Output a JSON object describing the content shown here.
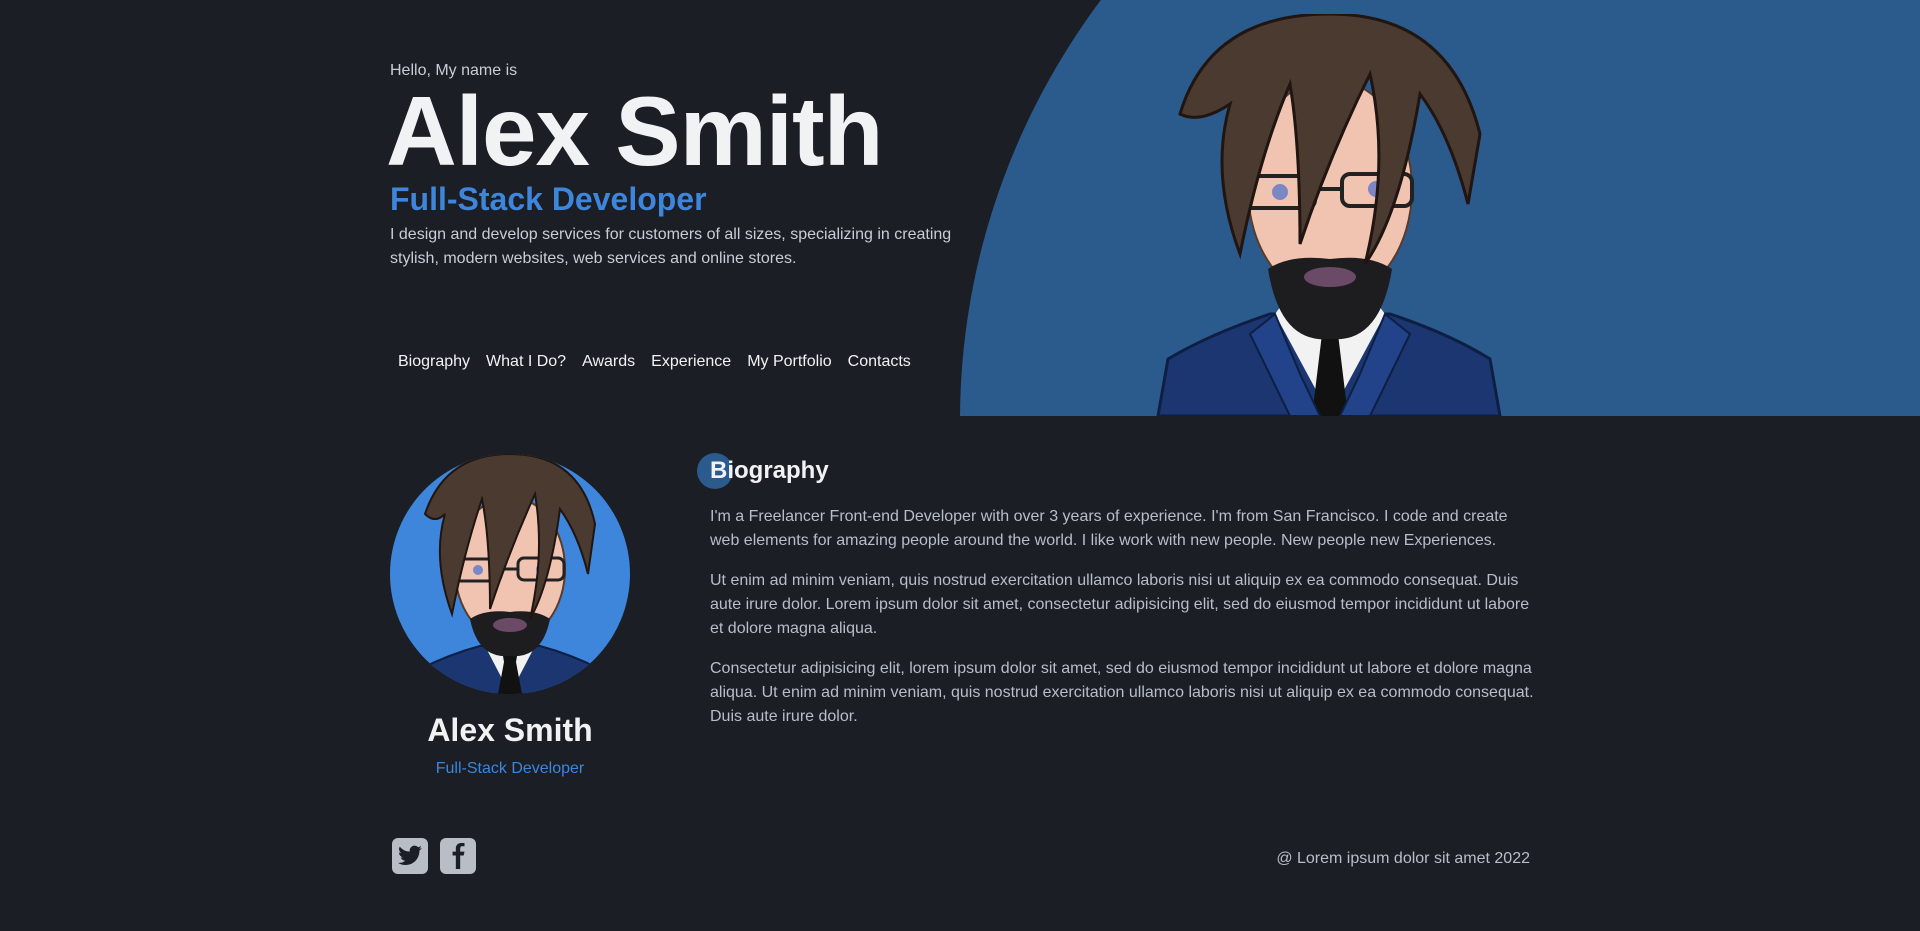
{
  "hero": {
    "greeting": "Hello, My name is",
    "name": "Alex Smith",
    "role": "Full-Stack Developer",
    "intro": "I design and develop services for customers of all sizes, specializing in creating stylish, modern websites, web services and online stores."
  },
  "nav": {
    "items": [
      "Biography",
      "What I Do?",
      "Awards",
      "Experience",
      "My Portfolio",
      "Contacts"
    ]
  },
  "profile": {
    "name": "Alex Smith",
    "role": "Full-Stack Developer"
  },
  "biography": {
    "title": "Biography",
    "paragraphs": [
      "I'm a Freelancer Front-end Developer with over 3 years of experience. I'm from San Francisco. I code and create web elements for amazing people around the world. I like work with new people. New people new Experiences.",
      "Ut enim ad minim veniam, quis nostrud exercitation ullamco laboris nisi ut aliquip ex ea commodo consequat. Duis aute irure dolor. Lorem ipsum dolor sit amet, consectetur adipisicing elit, sed do eiusmod tempor incididunt ut labore et dolore magna aliqua.",
      "Consectetur adipisicing elit, lorem ipsum dolor sit amet, sed do eiusmod tempor incididunt ut labore et dolore magna aliqua. Ut enim ad minim veniam, quis nostrud exercitation ullamco laboris nisi ut aliquip ex ea commodo consequat. Duis aute irure dolor."
    ]
  },
  "footer": {
    "social_icons": [
      "twitter-icon",
      "facebook-icon"
    ],
    "copyright": "@ Lorem ipsum dolor sit amet 2022"
  },
  "colors": {
    "background": "#1b1e25",
    "accent": "#3d86db",
    "hero_panel": "#2b5a8c",
    "heading": "#f1f2f4"
  }
}
